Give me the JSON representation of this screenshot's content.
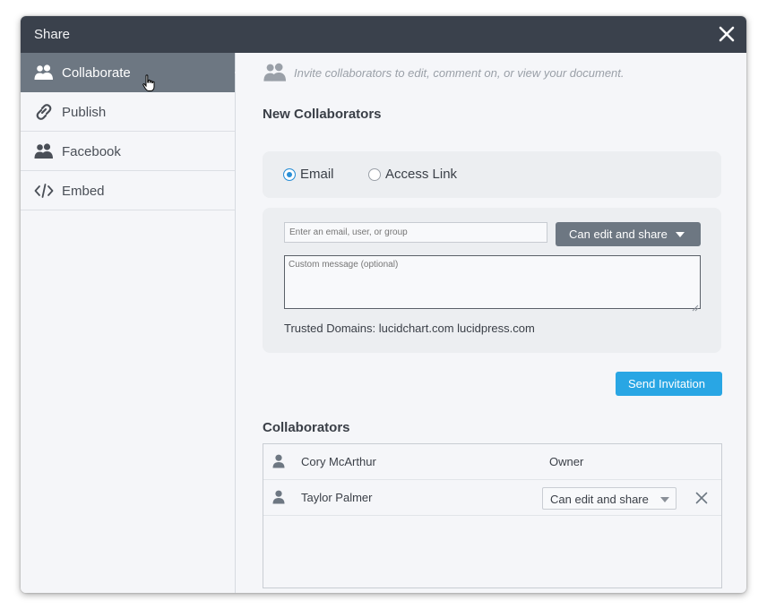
{
  "dialog": {
    "title": "Share",
    "close_icon": "close-icon"
  },
  "sidebar": {
    "items": [
      {
        "label": "Collaborate",
        "icon": "users-icon",
        "active": true
      },
      {
        "label": "Publish",
        "icon": "link-icon",
        "active": false
      },
      {
        "label": "Facebook",
        "icon": "users-icon",
        "active": false
      },
      {
        "label": "Embed",
        "icon": "code-icon",
        "active": false
      }
    ]
  },
  "content": {
    "hint": "Invite collaborators to edit, comment on, or view your document.",
    "new_collaborators_heading": "New Collaborators",
    "modes": [
      {
        "label": "Email",
        "selected": true
      },
      {
        "label": "Access Link",
        "selected": false
      }
    ],
    "email_placeholder": "Enter an email, user, or group",
    "permission_button": "Can edit and share",
    "message_placeholder": "Custom message (optional)",
    "trusted_domains": "Trusted Domains: lucidchart.com lucidpress.com",
    "send_button": "Send Invitation",
    "collaborators_heading": "Collaborators",
    "collaborators": [
      {
        "name": "Cory McArthur",
        "role": "Owner"
      },
      {
        "name": "Taylor Palmer",
        "role": "Can edit and share"
      }
    ]
  },
  "colors": {
    "titlebar": "#3a414c",
    "active_nav": "#6d7782",
    "send_button": "#29a6e4",
    "radio_selected": "#2b8fd6"
  }
}
